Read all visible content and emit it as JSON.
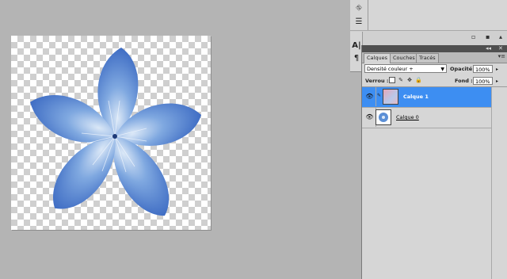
{
  "tool_panel": {
    "icons": [
      "histogram-icon",
      "adjust-stack-icon",
      "character-icon",
      "paragraph-icon"
    ],
    "footer_icons": [
      "new-item-icon",
      "trash-icon"
    ]
  },
  "layers_panel": {
    "tabs": [
      {
        "label": "Calques",
        "active": true
      },
      {
        "label": "Couches",
        "active": false
      },
      {
        "label": "Tracés",
        "active": false
      }
    ],
    "blend_mode": "Densité couleur +",
    "opacity_label": "Opacité :",
    "opacity_value": "100%",
    "lock_label": "Verrou :",
    "fill_label": "Fond :",
    "fill_value": "100%",
    "layers": [
      {
        "name": "Calque 1",
        "selected": true,
        "visible": true
      },
      {
        "name": "Calque 0",
        "selected": false,
        "visible": true
      }
    ]
  },
  "colors": {
    "workspace": "#b4b4b4",
    "panel": "#d6d6d6",
    "selection": "#3d8ef2",
    "flower": "#5b8fd6"
  }
}
